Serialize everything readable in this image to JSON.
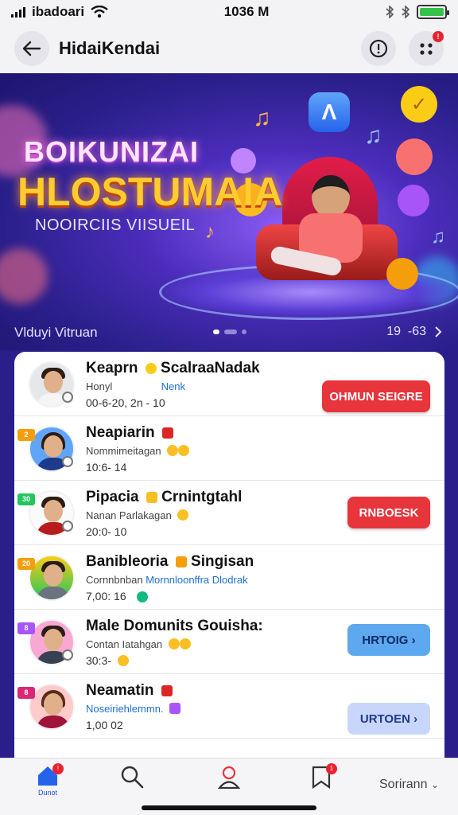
{
  "status_bar": {
    "carrier": "ibadoari",
    "time": "1036 M"
  },
  "header": {
    "title": "HidaiKendai",
    "notification_count": "!",
    "menu_badge": "!"
  },
  "banner": {
    "title_line1": "BOIKUNIZAI",
    "title_line2": "HLOSTUMAIA",
    "subtitle": "NOOIRCIIS VIISUEIL",
    "caption": "Vlduyi Vitruan",
    "counter": "19  -63"
  },
  "list": [
    {
      "name": "Keaprn",
      "name_suffix": "ScalraaNadak",
      "line1": "Honyl",
      "line1_blue": "Nenk",
      "line2": "00-6-20, 2n -  10",
      "tag": "",
      "tag_color": "",
      "shirt_color": "#f5f5f5",
      "button": "OHMUN SEIGRE",
      "button_style": "red"
    },
    {
      "name": "Neapiarin",
      "name_suffix": "",
      "line1": "Nommimeitagan",
      "line1_blue": "",
      "line2": "10:6- 14",
      "tag": "2",
      "tag_color": "#f59e0b",
      "shirt_color": "#1e3a8a",
      "button": "",
      "button_style": ""
    },
    {
      "name": "Pipacia",
      "name_suffix": "Crnintgtahl",
      "line1": "Nanan Parlakagan",
      "line1_blue": "",
      "line2": "20:0- 10",
      "tag": "30",
      "tag_color": "#22c55e",
      "shirt_color": "#b91c1c",
      "button": "RNBOESK",
      "button_style": "red"
    },
    {
      "name": "Banibleoria",
      "name_suffix": "Singisan",
      "line1": "Cornnbnban",
      "line1_blue": "Mornnloonffra Dlodrak",
      "line2": "7,00:         16",
      "tag": "20",
      "tag_color": "#f59e0b",
      "shirt_color": "#6b7280",
      "button": "",
      "button_style": ""
    },
    {
      "name": "Male Domunits Gouisha:",
      "name_suffix": "",
      "line1": "Contan Iatahgan",
      "line1_blue": "",
      "line2": "30:3-",
      "tag": "8",
      "tag_color": "#a855f7",
      "shirt_color": "#374151",
      "button": "HRTOIG ›",
      "button_style": "blue"
    },
    {
      "name": "Neamatin",
      "name_suffix": "",
      "line1": "",
      "line1_blue": "Noseiriehlemmn.",
      "line2": "1,00      02",
      "tag": "8",
      "tag_color": "#db2777",
      "shirt_color": "#9f1239",
      "button": "URTOEN ›",
      "button_style": "lavender"
    }
  ],
  "bottom_nav": {
    "home_label": "Dunot",
    "home_badge": "!",
    "bookmarks_badge": "1",
    "sort_label": "Sorirann"
  },
  "colors": {
    "accent_red": "#e8343b",
    "accent_blue": "#5ea8f0",
    "banner_bg": "#2a1f8a"
  }
}
